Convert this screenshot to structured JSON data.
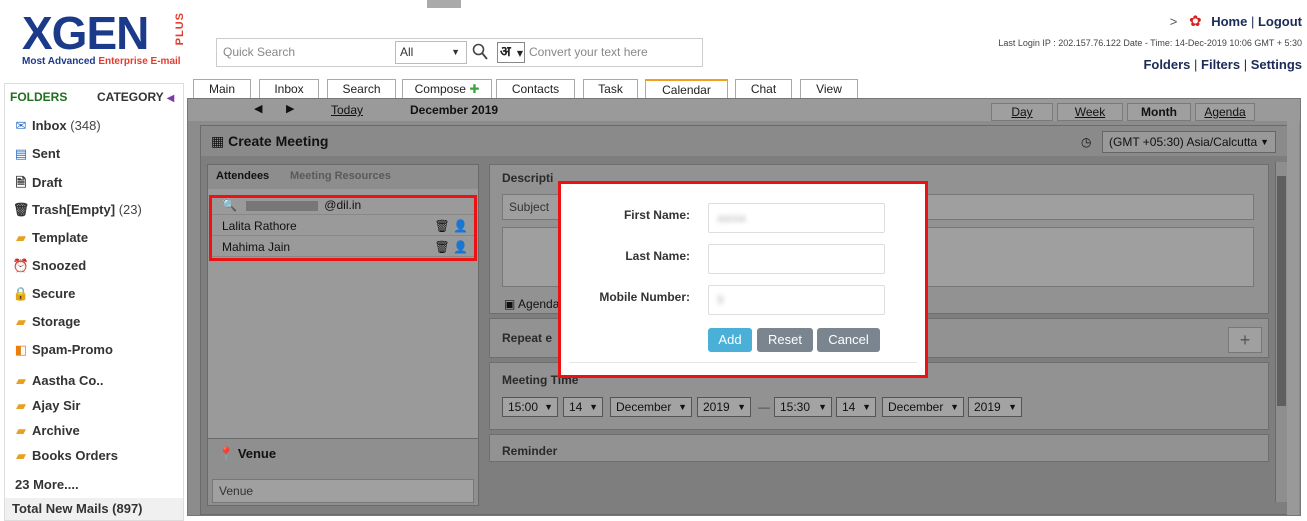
{
  "brand": {
    "name": "XGEN",
    "plus": "PLUS",
    "tagline_a": "Most Advanced ",
    "tagline_b": "Enterprise E-mail"
  },
  "search": {
    "placeholder": "Quick Search",
    "scope": "All",
    "lang_glyph": "अ",
    "convert_placeholder": "Convert your text here"
  },
  "top": {
    "home": "Home",
    "separator": "|",
    "logout": "Logout",
    "last_login": "Last Login IP : 202.157.76.122 Date - Time: 14-Dec-2019 10:06 GMT + 5:30",
    "folders": "Folders",
    "filters": "Filters",
    "settings": "Settings"
  },
  "sidebar": {
    "folders_head": "FOLDERS",
    "category_head": "CATEGORY",
    "items": [
      {
        "label": "Inbox",
        "count": "(348)",
        "icon": "inbox-icon"
      },
      {
        "label": "Sent",
        "count": "",
        "icon": "sent-icon"
      },
      {
        "label": "Draft",
        "count": "",
        "icon": "draft-icon"
      },
      {
        "label": "Trash[Empty]",
        "count": "(23)",
        "icon": "trash-icon"
      },
      {
        "label": "Template",
        "count": "",
        "icon": "folder-icon"
      },
      {
        "label": "Snoozed",
        "count": "",
        "icon": "clock-icon"
      },
      {
        "label": "Secure",
        "count": "",
        "icon": "lock-icon"
      },
      {
        "label": "Storage",
        "count": "",
        "icon": "storage-icon"
      },
      {
        "label": "Spam-Promo",
        "count": "",
        "icon": "spam-icon"
      }
    ],
    "custom": [
      "Aastha Co..",
      "Ajay Sir",
      "Archive",
      "Books Orders"
    ],
    "more": "23 More....",
    "total": "Total New Mails (897)"
  },
  "tabs": [
    "Main",
    "Inbox",
    "Search",
    "Compose",
    "Contacts",
    "Task",
    "Calendar",
    "Chat",
    "View"
  ],
  "calendar": {
    "today": "Today",
    "month_label": "December 2019",
    "views": [
      "Day",
      "Week",
      "Month",
      "Agenda"
    ]
  },
  "meeting": {
    "title": "Create Meeting",
    "timezone": "(GMT +05:30) Asia/Calcutta",
    "att_tab1": "Attendees",
    "att_tab2": "Meeting Resources",
    "search_value": "@dil.in",
    "attendees": [
      "Lalita Rathore",
      "Mahima Jain"
    ],
    "venue_title": "Venue",
    "venue_placeholder": "Venue",
    "description_title": "Descripti",
    "subject_placeholder": "Subject",
    "agenda_label": "Agenda",
    "repeat_label": "Repeat e",
    "time_title": "Meeting Time",
    "start": {
      "hour": "15:00",
      "day": "14",
      "month": "December",
      "year": "2019"
    },
    "dash": "—",
    "end": {
      "hour": "15:30",
      "day": "14",
      "month": "December",
      "year": "2019"
    },
    "reminder_title": "Reminder"
  },
  "modal": {
    "first_label": "First Name:",
    "first_value": "aasia",
    "last_label": "Last Name:",
    "last_value": "",
    "mobile_label": "Mobile Number:",
    "mobile_value": "9",
    "add": "Add",
    "reset": "Reset",
    "cancel": "Cancel",
    "add_color": "#4bb0d8",
    "btn_color": "#7a8590"
  }
}
